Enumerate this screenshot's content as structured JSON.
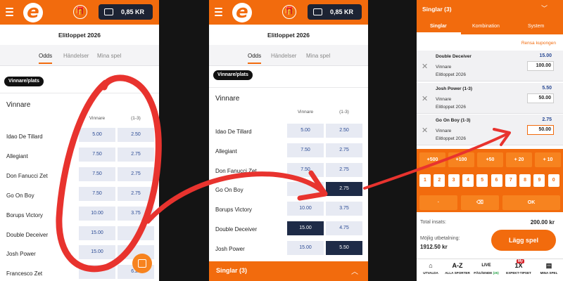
{
  "header": {
    "balance": "0,85 KR",
    "logo_letter": "e"
  },
  "event": {
    "title": "Elitloppet 2026"
  },
  "tabs": [
    "Odds",
    "Händelser",
    "Mina spel"
  ],
  "chip": "Vinnare/plats",
  "section": {
    "title": "Vinnare",
    "col_win": "Vinnare",
    "col_place": "(1-3)"
  },
  "panel1": {
    "runners": [
      {
        "name": "Idao De Tillard",
        "win": "5.00",
        "place": "2.50"
      },
      {
        "name": "Allegiant",
        "win": "7.50",
        "place": "2.75"
      },
      {
        "name": "Don Fanucci Zet",
        "win": "7.50",
        "place": "2.75"
      },
      {
        "name": "Go On Boy",
        "win": "7.50",
        "place": "2.75"
      },
      {
        "name": "Borups Victory",
        "win": "10.00",
        "place": "3.75"
      },
      {
        "name": "Double Deceiver",
        "win": "15.00",
        "place": ""
      },
      {
        "name": "Josh Power",
        "win": "15.00",
        "place": ""
      },
      {
        "name": "Francesco Zet",
        "win": "",
        "place": "6.25"
      }
    ]
  },
  "panel2": {
    "runners": [
      {
        "name": "Idao De Tillard",
        "win": "5.00",
        "place": "2.50"
      },
      {
        "name": "Allegiant",
        "win": "7.50",
        "place": "2.75"
      },
      {
        "name": "Don Fanucci Zet",
        "win": "7.50",
        "place": "2.75"
      },
      {
        "name": "Go On Boy",
        "win": "",
        "place": "2.75"
      },
      {
        "name": "Borups Victory",
        "win": "10.00",
        "place": "3.75"
      },
      {
        "name": "Double Deceiver",
        "win": "15.00",
        "place": "4.75"
      },
      {
        "name": "Josh Power",
        "win": "15.00",
        "place": "5.50"
      }
    ],
    "footer": "Singlar (3)"
  },
  "slip": {
    "title": "Singlar (3)",
    "tabs": [
      "Singlar",
      "Kombination",
      "System"
    ],
    "clear": "Rensa kupongen",
    "bets": [
      {
        "name": "Double Deceiver",
        "odds": "15.00",
        "type": "Vinnare",
        "event": "Elitloppet 2026",
        "stake": "100.00"
      },
      {
        "name": "Josh Power (1-3)",
        "odds": "5.50",
        "type": "Vinnare",
        "event": "Elitloppet 2026",
        "stake": "50.00"
      },
      {
        "name": "Go On Boy (1-3)",
        "odds": "2.75",
        "type": "Vinnare",
        "event": "Elitloppet 2026",
        "stake": "50.00"
      }
    ],
    "quick": [
      "+500",
      "+100",
      "+50",
      "+ 20",
      "+ 10"
    ],
    "digits": [
      "1",
      "2",
      "3",
      "4",
      "5",
      "6",
      "7",
      "8",
      "9",
      "0"
    ],
    "dot": "·",
    "ok": "OK",
    "total_label": "Total insats:",
    "total_value": "200.00 kr",
    "payout_label": "Möjlig utbetalning:",
    "payout_value": "1912.50 kr",
    "place_bet": "Lägg spel"
  },
  "bottom_nav": [
    {
      "icon": "home-icon",
      "glyph": "⌂",
      "label": "UTVALDA"
    },
    {
      "icon": "az-icon",
      "glyph": "A-Z",
      "label": "ALLA SPORTER"
    },
    {
      "icon": "live-icon",
      "glyph": "LIVE",
      "label": "PÅGÅENDE",
      "count": "(25)"
    },
    {
      "icon": "expekt-tipset-icon",
      "glyph": "1X",
      "label": "EXPEKT-TIPSET",
      "badge": "My"
    },
    {
      "icon": "betslip-icon",
      "glyph": "▤",
      "label": "MINA SPEL"
    }
  ],
  "colors": {
    "brand": "#f26b0d",
    "odds_bg": "#e7eaf3",
    "odds_selected": "#1e2b47",
    "annotation": "#e8332e"
  }
}
